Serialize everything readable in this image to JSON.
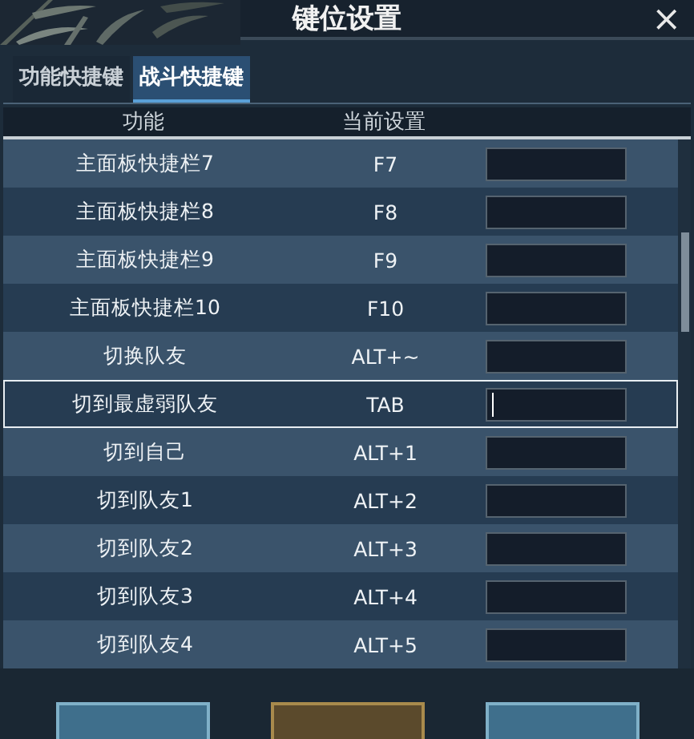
{
  "window": {
    "title": "键位设置",
    "close": "×"
  },
  "tabs": [
    {
      "label": "功能快捷键",
      "selected": false
    },
    {
      "label": "战斗快捷键",
      "selected": true
    }
  ],
  "table": {
    "columns": [
      "功能",
      "当前设置"
    ],
    "rows": [
      {
        "action": "主面板快捷栏7",
        "current": "F7",
        "selected": false
      },
      {
        "action": "主面板快捷栏8",
        "current": "F8",
        "selected": false
      },
      {
        "action": "主面板快捷栏9",
        "current": "F9",
        "selected": false
      },
      {
        "action": "主面板快捷栏10",
        "current": "F10",
        "selected": false
      },
      {
        "action": "切换队友",
        "current": "ALT+~",
        "selected": false
      },
      {
        "action": "切到最虚弱队友",
        "current": "TAB",
        "selected": true
      },
      {
        "action": "切到自己",
        "current": "ALT+1",
        "selected": false
      },
      {
        "action": "切到队友1",
        "current": "ALT+2",
        "selected": false
      },
      {
        "action": "切到队友2",
        "current": "ALT+3",
        "selected": false
      },
      {
        "action": "切到队友3",
        "current": "ALT+4",
        "selected": false
      },
      {
        "action": "切到队友4",
        "current": "ALT+5",
        "selected": false
      }
    ]
  },
  "footer_buttons": [
    {
      "kind": "blue"
    },
    {
      "kind": "gold"
    },
    {
      "kind": "blue"
    }
  ]
}
